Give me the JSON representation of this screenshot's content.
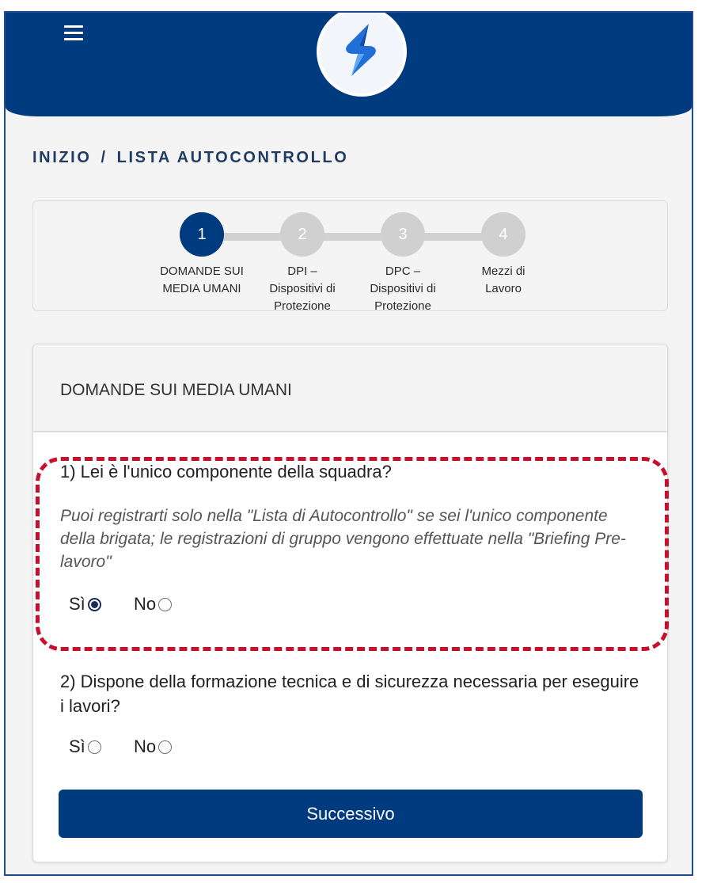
{
  "header": {
    "menu_icon": "hamburger-icon",
    "logo_icon": "s-logo-icon",
    "brand_color": "#003a7f"
  },
  "breadcrumb": {
    "home": "INIZIO",
    "separator": "/",
    "current": "LISTA AUTOCONTROLLO"
  },
  "stepper": {
    "steps": [
      {
        "number": "1",
        "line1": "DOMANDE SUI",
        "line2": "MEDIA UMANI",
        "line3": "",
        "active": true
      },
      {
        "number": "2",
        "line1": "DPI –",
        "line2": "Dispositivi di",
        "line3": "Protezione",
        "active": false
      },
      {
        "number": "3",
        "line1": "DPC –",
        "line2": "Dispositivi di",
        "line3": "Protezione",
        "active": false
      },
      {
        "number": "4",
        "line1": "Mezzi di",
        "line2": "Lavoro",
        "line3": "",
        "active": false
      }
    ]
  },
  "form": {
    "title": "DOMANDE SUI MEDIA UMANI",
    "questions": [
      {
        "text": "1) Lei è l'unico componente della squadra?",
        "hint": "Puoi registrarti solo nella \"Lista di Autocontrollo\" se sei l'unico componente della brigata; le registrazioni di gruppo vengono effettuate nella \"Briefing Pre-lavoro\"",
        "options": [
          "Sì",
          "No"
        ],
        "selected": "Sì"
      },
      {
        "text": "2) Dispone della formazione tecnica e di sicurezza necessaria per eseguire i lavori?",
        "hint": "",
        "options": [
          "Sì",
          "No"
        ],
        "selected": ""
      }
    ],
    "next_button": "Successivo",
    "highlight_color": "#c8102e"
  }
}
